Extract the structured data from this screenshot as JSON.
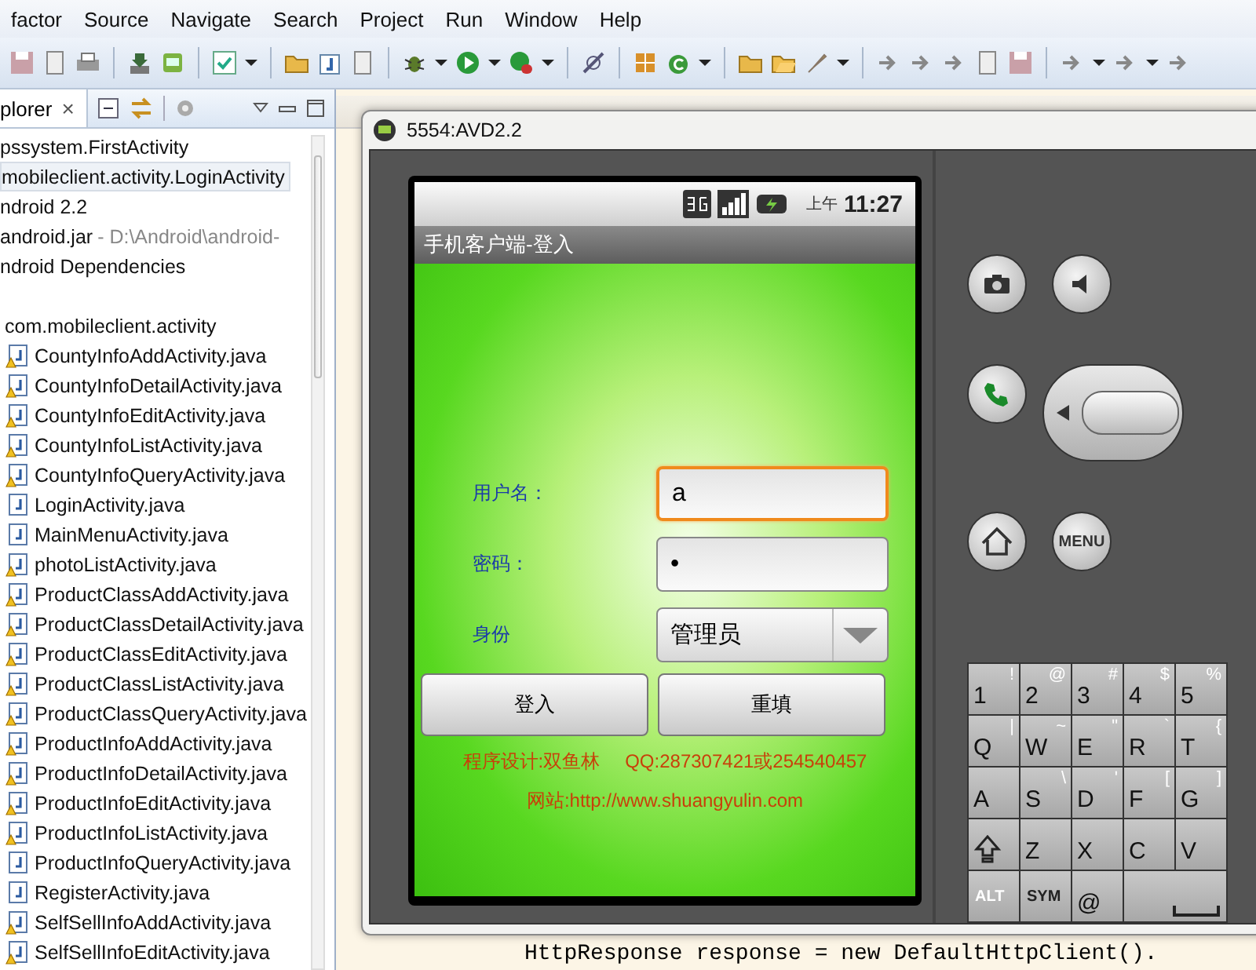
{
  "menu": [
    "factor",
    "Source",
    "Navigate",
    "Search",
    "Project",
    "Run",
    "Window",
    "Help"
  ],
  "explorer": {
    "title": "plorer",
    "close": "×",
    "items": [
      {
        "label": "pssystem.FirstActivity",
        "selected": false
      },
      {
        "label": "mobileclient.activity.LoginActivity",
        "selected": true
      },
      {
        "label": "ndroid 2.2",
        "selected": false
      },
      {
        "label": "android.jar",
        "path": "- D:\\Android\\android-",
        "selected": false
      },
      {
        "label": "ndroid Dependencies",
        "selected": false
      },
      {
        "label": "com.mobileclient.activity",
        "selected": false,
        "children": [
          {
            "label": "CountyInfoAddActivity.java",
            "warning": true,
            "selected": false
          },
          {
            "label": "CountyInfoDetailActivity.java",
            "warning": true,
            "selected": false
          },
          {
            "label": "CountyInfoEditActivity.java",
            "warning": true,
            "selected": false
          },
          {
            "label": "CountyInfoListActivity.java",
            "warning": true,
            "selected": false
          },
          {
            "label": "CountyInfoQueryActivity.java",
            "warning": true,
            "selected": false
          },
          {
            "label": "LoginActivity.java",
            "warning": false,
            "selected": false
          },
          {
            "label": "MainMenuActivity.java",
            "warning": false,
            "selected": false
          },
          {
            "label": "photoListActivity.java",
            "warning": true,
            "selected": false
          },
          {
            "label": "ProductClassAddActivity.java",
            "warning": true,
            "selected": false
          },
          {
            "label": "ProductClassDetailActivity.java",
            "warning": true,
            "selected": false
          },
          {
            "label": "ProductClassEditActivity.java",
            "warning": true,
            "selected": false
          },
          {
            "label": "ProductClassListActivity.java",
            "warning": true,
            "selected": false
          },
          {
            "label": "ProductClassQueryActivity.java",
            "warning": true,
            "selected": false
          },
          {
            "label": "ProductInfoAddActivity.java",
            "warning": true,
            "selected": false
          },
          {
            "label": "ProductInfoDetailActivity.java",
            "warning": true,
            "selected": false
          },
          {
            "label": "ProductInfoEditActivity.java",
            "warning": true,
            "selected": false
          },
          {
            "label": "ProductInfoListActivity.java",
            "warning": true,
            "selected": false
          },
          {
            "label": "ProductInfoQueryActivity.java",
            "warning": false,
            "selected": false
          },
          {
            "label": "RegisterActivity.java",
            "warning": false,
            "selected": false
          },
          {
            "label": "SelfSellInfoAddActivity.java",
            "warning": true,
            "selected": false
          },
          {
            "label": "SelfSellInfoEditActivity.java",
            "warning": true,
            "selected": false
          }
        ]
      }
    ]
  },
  "emulator": {
    "title": "5554:AVD2.2",
    "ampm": "上午",
    "time": "11:27",
    "app_title": "手机客户端-登入",
    "fields": [
      {
        "kind": "text",
        "label": "用户名：",
        "value": "a",
        "focused": true
      },
      {
        "kind": "password",
        "label": "密码：",
        "value": "•",
        "focused": false
      },
      {
        "kind": "select",
        "label": "身份",
        "value": "管理员",
        "focused": false
      }
    ],
    "buttons": [
      "登入",
      "重填"
    ],
    "credits": [
      [
        "程序设计:双鱼林",
        "QQ:287307421或254540457"
      ],
      [
        "网站:http://www.shuangyulin.com"
      ]
    ],
    "menu_button": "MENU",
    "keyboard": [
      [
        {
          "kind": "char",
          "main": "1",
          "alt": "!"
        },
        {
          "kind": "char",
          "main": "2",
          "alt": "@"
        },
        {
          "kind": "char",
          "main": "3",
          "alt": "#"
        },
        {
          "kind": "char",
          "main": "4",
          "alt": "$"
        },
        {
          "kind": "char",
          "main": "5",
          "alt": "%"
        }
      ],
      [
        {
          "kind": "char",
          "main": "Q",
          "alt": "|"
        },
        {
          "kind": "char",
          "main": "W",
          "alt": "~"
        },
        {
          "kind": "char",
          "main": "E",
          "alt": "\""
        },
        {
          "kind": "char",
          "main": "R",
          "alt": "`"
        },
        {
          "kind": "char",
          "main": "T",
          "alt": "{"
        }
      ],
      [
        {
          "kind": "char",
          "main": "A"
        },
        {
          "kind": "char",
          "main": "S",
          "alt": "\\"
        },
        {
          "kind": "char",
          "main": "D",
          "alt": "'"
        },
        {
          "kind": "char",
          "main": "F",
          "alt": "["
        },
        {
          "kind": "char",
          "main": "G",
          "alt": "]"
        }
      ],
      [
        {
          "kind": "shift"
        },
        {
          "kind": "char",
          "main": "Z"
        },
        {
          "kind": "char",
          "main": "X"
        },
        {
          "kind": "char",
          "main": "C"
        },
        {
          "kind": "char",
          "main": "V"
        }
      ],
      [
        {
          "kind": "mod",
          "main": "ALT"
        },
        {
          "kind": "mod",
          "main": "SYM"
        },
        {
          "kind": "char",
          "main": "@"
        },
        {
          "kind": "space"
        }
      ]
    ]
  },
  "code_line": "HttpResponse response = new DefaultHttpClient()."
}
